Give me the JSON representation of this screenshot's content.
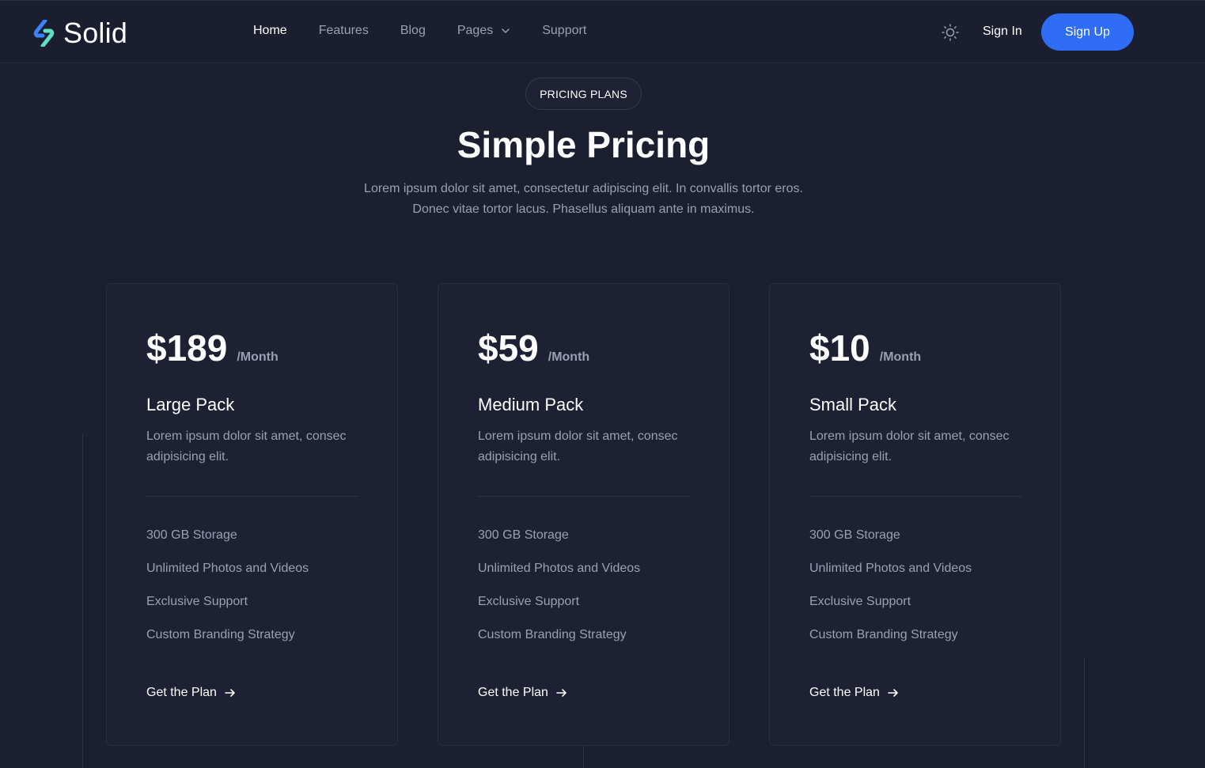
{
  "colors": {
    "background": "#1c1f30",
    "card_background": "#1d2133",
    "accent": "#2f6df6",
    "muted_text": "#9aa0b3",
    "logo_blue": "#3b82f6",
    "logo_teal": "#5de0c5"
  },
  "header": {
    "logo_text": "Solid",
    "nav": [
      {
        "label": "Home",
        "active": true
      },
      {
        "label": "Features",
        "active": false
      },
      {
        "label": "Blog",
        "active": false
      },
      {
        "label": "Pages",
        "active": false,
        "has_dropdown": true
      },
      {
        "label": "Support",
        "active": false
      }
    ],
    "theme_toggle_icon": "sun-icon",
    "sign_in_label": "Sign In",
    "sign_up_label": "Sign Up"
  },
  "hero": {
    "badge": "PRICING PLANS",
    "title": "Simple Pricing",
    "subtitle_line1": "Lorem ipsum dolor sit amet, consectetur adipiscing elit. In convallis tortor eros.",
    "subtitle_line2": "Donec vitae tortor lacus. Phasellus aliquam ante in maximus."
  },
  "plans": [
    {
      "price": "$189",
      "period": "/Month",
      "name": "Large Pack",
      "description": "Lorem ipsum dolor sit amet, consec adipisicing elit.",
      "features": [
        "300 GB Storage",
        "Unlimited Photos and Videos",
        "Exclusive Support",
        "Custom Branding Strategy"
      ],
      "cta_label": "Get the Plan"
    },
    {
      "price": "$59",
      "period": "/Month",
      "name": "Medium Pack",
      "description": "Lorem ipsum dolor sit amet, consec adipisicing elit.",
      "features": [
        "300 GB Storage",
        "Unlimited Photos and Videos",
        "Exclusive Support",
        "Custom Branding Strategy"
      ],
      "cta_label": "Get the Plan"
    },
    {
      "price": "$10",
      "period": "/Month",
      "name": "Small Pack",
      "description": "Lorem ipsum dolor sit amet, consec adipisicing elit.",
      "features": [
        "300 GB Storage",
        "Unlimited Photos and Videos",
        "Exclusive Support",
        "Custom Branding Strategy"
      ],
      "cta_label": "Get the Plan"
    }
  ]
}
